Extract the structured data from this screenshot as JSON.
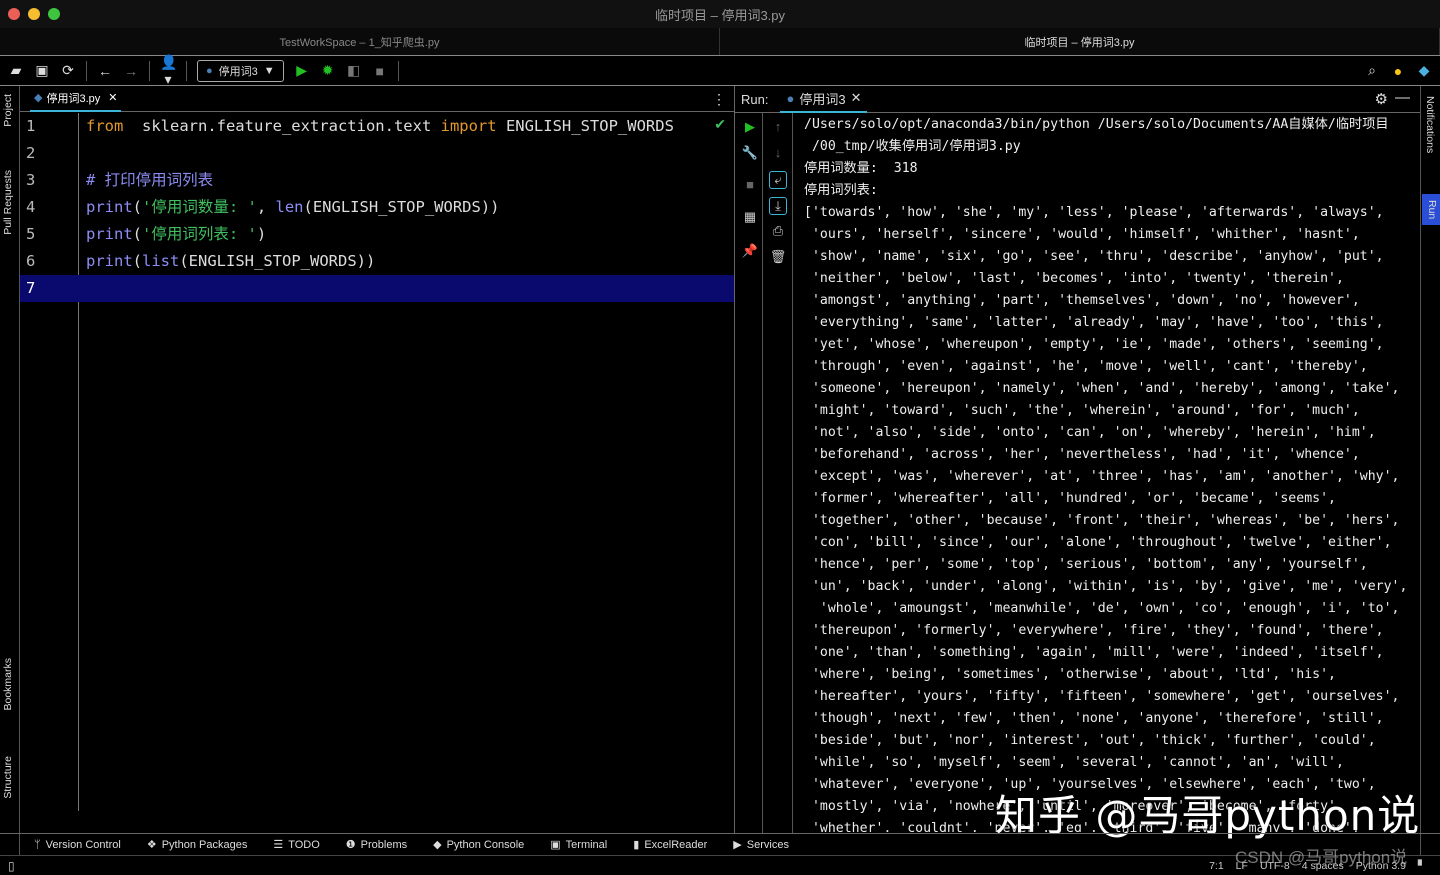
{
  "window": {
    "title": "临时项目 – 停用词3.py",
    "tabs": [
      "TestWorkSpace – 1_知乎爬虫.py",
      "临时项目 – 停用词3.py"
    ]
  },
  "toolbar": {
    "run_config": "停用词3",
    "icons": [
      "open-folder-icon",
      "save-icon",
      "sync-icon",
      "back-icon",
      "forward-icon",
      "vcs-user-icon",
      "run-icon",
      "debug-icon",
      "coverage-icon",
      "stop-icon",
      "search-icon",
      "update-icon",
      "plugin-icon"
    ]
  },
  "left_strip": [
    "Project",
    "Pull Requests",
    "Bookmarks",
    "Structure"
  ],
  "right_strip": [
    "Notifications",
    "Run"
  ],
  "editor": {
    "tab": "停用词3.py",
    "lines": [
      {
        "n": "1",
        "html": [
          [
            "kw",
            "from"
          ],
          [
            "",
            "  sklearn.feature_extraction.text "
          ],
          [
            "kw",
            "import"
          ],
          [
            "",
            " ENGLISH_STOP_WORDS"
          ]
        ]
      },
      {
        "n": "2",
        "html": []
      },
      {
        "n": "3",
        "html": [
          [
            "cm",
            "# 打印停用词列表"
          ]
        ]
      },
      {
        "n": "4",
        "html": [
          [
            "fn",
            "print"
          ],
          [
            "",
            "("
          ],
          [
            "str",
            "'停用词数量: '"
          ],
          [
            "",
            ", "
          ],
          [
            "fn",
            "len"
          ],
          [
            "",
            "(ENGLISH_STOP_WORDS))"
          ]
        ]
      },
      {
        "n": "5",
        "html": [
          [
            "fn",
            "print"
          ],
          [
            "",
            "("
          ],
          [
            "str",
            "'停用词列表: '"
          ],
          [
            "",
            ")"
          ]
        ]
      },
      {
        "n": "6",
        "html": [
          [
            "fn",
            "print"
          ],
          [
            "",
            "("
          ],
          [
            "fn",
            "list"
          ],
          [
            "",
            "(ENGLISH_STOP_WORDS))"
          ]
        ]
      },
      {
        "n": "7",
        "html": []
      }
    ],
    "current_line": "7"
  },
  "run": {
    "label": "Run:",
    "tab": "停用词3",
    "output": [
      "/Users/solo/opt/anaconda3/bin/python /Users/solo/Documents/AA自媒体/临时项目",
      " /00_tmp/收集停用词/停用词3.py",
      "停用词数量:  318",
      "停用词列表:",
      "['towards', 'how', 'she', 'my', 'less', 'please', 'afterwards', 'always',",
      " 'ours', 'herself', 'sincere', 'would', 'himself', 'whither', 'hasnt',",
      " 'show', 'name', 'six', 'go', 'see', 'thru', 'describe', 'anyhow', 'put',",
      " 'neither', 'below', 'last', 'becomes', 'into', 'twenty', 'therein',",
      " 'amongst', 'anything', 'part', 'themselves', 'down', 'no', 'however',",
      " 'everything', 'same', 'latter', 'already', 'may', 'have', 'too', 'this',",
      " 'yet', 'whose', 'whereupon', 'empty', 'ie', 'made', 'others', 'seeming',",
      " 'through', 'even', 'against', 'he', 'move', 'well', 'cant', 'thereby',",
      " 'someone', 'hereupon', 'namely', 'when', 'and', 'hereby', 'among', 'take',",
      " 'might', 'toward', 'such', 'the', 'wherein', 'around', 'for', 'much',",
      " 'not', 'also', 'side', 'onto', 'can', 'on', 'whereby', 'herein', 'him',",
      " 'beforehand', 'across', 'her', 'nevertheless', 'had', 'it', 'whence',",
      " 'except', 'was', 'wherever', 'at', 'three', 'has', 'am', 'another', 'why',",
      " 'former', 'whereafter', 'all', 'hundred', 'or', 'became', 'seems',",
      " 'together', 'other', 'because', 'front', 'their', 'whereas', 'be', 'hers',",
      " 'con', 'bill', 'since', 'our', 'alone', 'throughout', 'twelve', 'either',",
      " 'hence', 'per', 'some', 'top', 'serious', 'bottom', 'any', 'yourself',",
      " 'un', 'back', 'under', 'along', 'within', 'is', 'by', 'give', 'me', 'very',",
      "  'whole', 'amoungst', 'meanwhile', 'de', 'own', 'co', 'enough', 'i', 'to',",
      " 'thereupon', 'formerly', 'everywhere', 'fire', 'they', 'found', 'there',",
      " 'one', 'than', 'something', 'again', 'mill', 'were', 'indeed', 'itself',",
      " 'where', 'being', 'sometimes', 'otherwise', 'about', 'ltd', 'his',",
      " 'hereafter', 'yours', 'fifty', 'fifteen', 'somewhere', 'get', 'ourselves',",
      " 'though', 'next', 'few', 'then', 'none', 'anyone', 'therefore', 'still',",
      " 'beside', 'but', 'nor', 'interest', 'out', 'thick', 'further', 'could',",
      " 'while', 'so', 'myself', 'seem', 'several', 'cannot', 'an', 'will',",
      " 'whatever', 'everyone', 'up', 'yourselves', 'elsewhere', 'each', 'two',",
      " 'mostly', 'via', 'nowhere', 'until', 'moreover', 'become', 'forty',",
      " 'whether', 'couldnt', 'never', 'eg', 'third', 'five', 'many', 'done',"
    ]
  },
  "watermark": "知乎 @马哥python说",
  "csdn_watermark": "CSDN @马哥python说",
  "tool_windows": [
    "Version Control",
    "Python Packages",
    "TODO",
    "Problems",
    "Python Console",
    "Terminal",
    "ExcelReader",
    "Services"
  ],
  "status": [
    "7:1",
    "LF",
    "UTF-8",
    "4 spaces",
    "Python 3.9"
  ],
  "colors": {
    "keyword": "#e0982c",
    "string": "#3fbf5f",
    "function": "#8c8cf5",
    "current_line": "#0a0a6e",
    "accent": "#3ab5d6",
    "run_green": "#22c022"
  }
}
